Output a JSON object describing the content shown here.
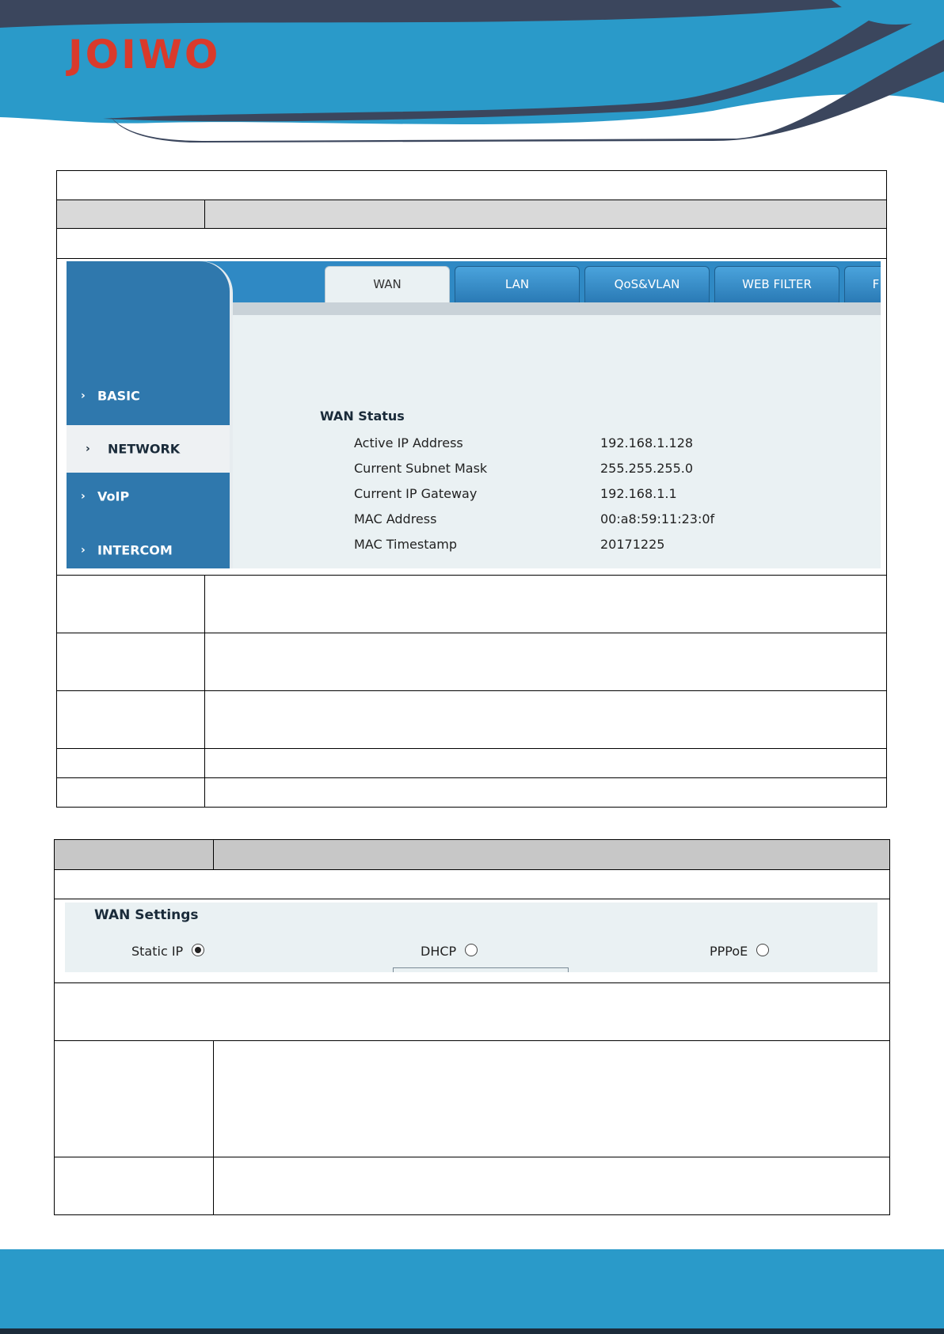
{
  "brand": {
    "logo_text": "JOIWO",
    "colors": {
      "blue": "#2a9ac9",
      "navy": "#3b465d",
      "logo_red": "#d93a2b"
    }
  },
  "network_ui": {
    "nav": [
      {
        "label": "BASIC",
        "active": false
      },
      {
        "label": "NETWORK",
        "active": true
      },
      {
        "label": "VoIP",
        "active": false
      },
      {
        "label": "INTERCOM",
        "active": false
      }
    ],
    "tabs": [
      {
        "label": "WAN",
        "active": true
      },
      {
        "label": "LAN",
        "active": false
      },
      {
        "label": "QoS&VLAN",
        "active": false
      },
      {
        "label": "WEB FILTER",
        "active": false
      },
      {
        "label": "F",
        "active": false
      }
    ],
    "wan_status": {
      "title": "WAN Status",
      "rows": [
        {
          "label": "Active IP Address",
          "value": "192.168.1.128"
        },
        {
          "label": "Current Subnet Mask",
          "value": "255.255.255.0"
        },
        {
          "label": "Current IP Gateway",
          "value": "192.168.1.1"
        },
        {
          "label": "MAC Address",
          "value": "00:a8:59:11:23:0f"
        },
        {
          "label": "MAC Timestamp",
          "value": "20171225"
        }
      ]
    }
  },
  "wan_settings_ui": {
    "title": "WAN Settings",
    "options": [
      {
        "label": "Static IP",
        "selected": true
      },
      {
        "label": "DHCP",
        "selected": false
      },
      {
        "label": "PPPoE",
        "selected": false
      }
    ]
  }
}
